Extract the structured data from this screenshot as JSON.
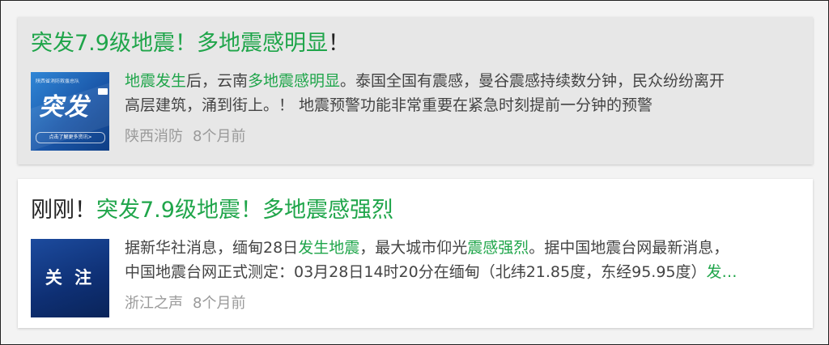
{
  "results": [
    {
      "title": [
        {
          "text": "突发7.9级地震！多地震感明显",
          "hl": true
        },
        {
          "text": "！",
          "hl": false
        }
      ],
      "thumbnail": {
        "style": "blue-breaking",
        "main_text": "突发",
        "top_text": "陕西省消防救援总队",
        "pill_text": "点击了解更多资讯>"
      },
      "desc_lines": [
        [
          {
            "text": "地震发生",
            "hl": true
          },
          {
            "text": "后，云南",
            "hl": false
          },
          {
            "text": "多地震感明显",
            "hl": true
          },
          {
            "text": "。泰国全国有震感，曼谷震感持续数分钟，民众纷纷离开",
            "hl": false
          }
        ],
        [
          {
            "text": "高层建筑，涌到街上。！ 地震预警功能非常重要在紧急时刻提前一分钟的预警",
            "hl": false
          }
        ]
      ],
      "source": "陕西消防",
      "time": "8个月前",
      "selected": true
    },
    {
      "title": [
        {
          "text": "刚刚！",
          "hl": false
        },
        {
          "text": "突发7.9级地震！多地震感强烈",
          "hl": true
        }
      ],
      "thumbnail": {
        "style": "navy-attention",
        "main_text": "关 注"
      },
      "desc_lines": [
        [
          {
            "text": "据新华社消息，缅甸28日",
            "hl": false
          },
          {
            "text": "发生地震",
            "hl": true
          },
          {
            "text": "，最大城市仰光",
            "hl": false
          },
          {
            "text": "震感强烈",
            "hl": true
          },
          {
            "text": "。据中国地震台网最新消息，",
            "hl": false
          }
        ],
        [
          {
            "text": "中国地震台网正式测定：03月28日14时20分在缅甸（北纬21.85度，东经95.95度）",
            "hl": false
          },
          {
            "text": "发…",
            "hl": true
          }
        ]
      ],
      "source": "浙江之声",
      "time": "8个月前",
      "selected": false
    }
  ],
  "colors": {
    "highlight": "#1fa54a",
    "text": "#444444",
    "meta": "#9a9a9a",
    "selected_bg": "#e7e7e7",
    "card_bg": "#ffffff"
  }
}
